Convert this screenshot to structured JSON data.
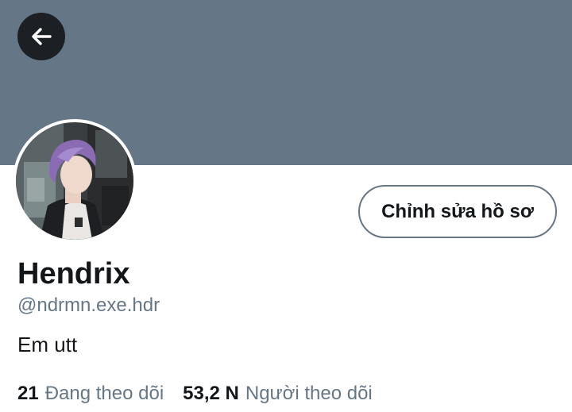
{
  "colors": {
    "banner": "#657786",
    "primary_text": "#14171a",
    "secondary_text": "#657786",
    "back_button_bg": "#1c1f23"
  },
  "header": {
    "back_icon": "arrow-left-icon"
  },
  "profile": {
    "edit_button_label": "Chỉnh sửa hồ sơ",
    "display_name": "Hendrix",
    "handle": "@ndrmn.exe.hdr",
    "bio": "Em utt"
  },
  "stats": {
    "following_count": "21",
    "following_label": "Đang theo dõi",
    "followers_count": "53,2 N",
    "followers_label": "Người theo dõi"
  }
}
